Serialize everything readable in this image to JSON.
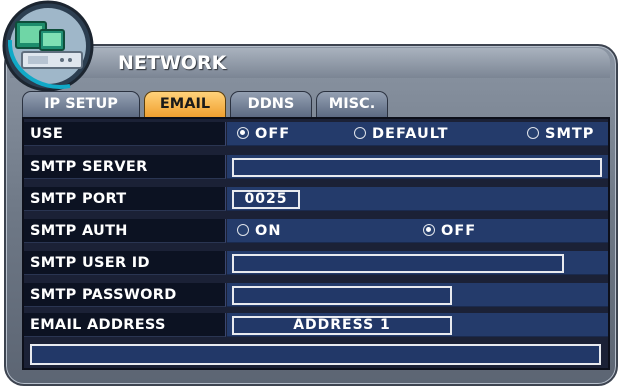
{
  "window": {
    "title": "NETWORK"
  },
  "tabs": [
    {
      "label": "IP SETUP",
      "active": false
    },
    {
      "label": "EMAIL",
      "active": true
    },
    {
      "label": "DDNS",
      "active": false
    },
    {
      "label": "MISC.",
      "active": false
    }
  ],
  "use": {
    "label": "USE",
    "options": [
      "OFF",
      "DEFAULT",
      "SMTP"
    ],
    "selected": "OFF"
  },
  "smtp_server": {
    "label": "SMTP SERVER",
    "value": ""
  },
  "smtp_port": {
    "label": "SMTP PORT",
    "value": "0025"
  },
  "smtp_auth": {
    "label": "SMTP AUTH",
    "options": [
      "ON",
      "OFF"
    ],
    "selected": "OFF"
  },
  "smtp_user_id": {
    "label": "SMTP USER ID",
    "value": ""
  },
  "smtp_password": {
    "label": "SMTP PASSWORD",
    "value": ""
  },
  "email_address": {
    "label": "EMAIL ADDRESS",
    "value": "ADDRESS 1"
  },
  "status_bar": {
    "text": ""
  },
  "colors": {
    "active_tab": "#f0a030",
    "panel_bg": "#1b2136",
    "value_bg": "#243b6b"
  }
}
